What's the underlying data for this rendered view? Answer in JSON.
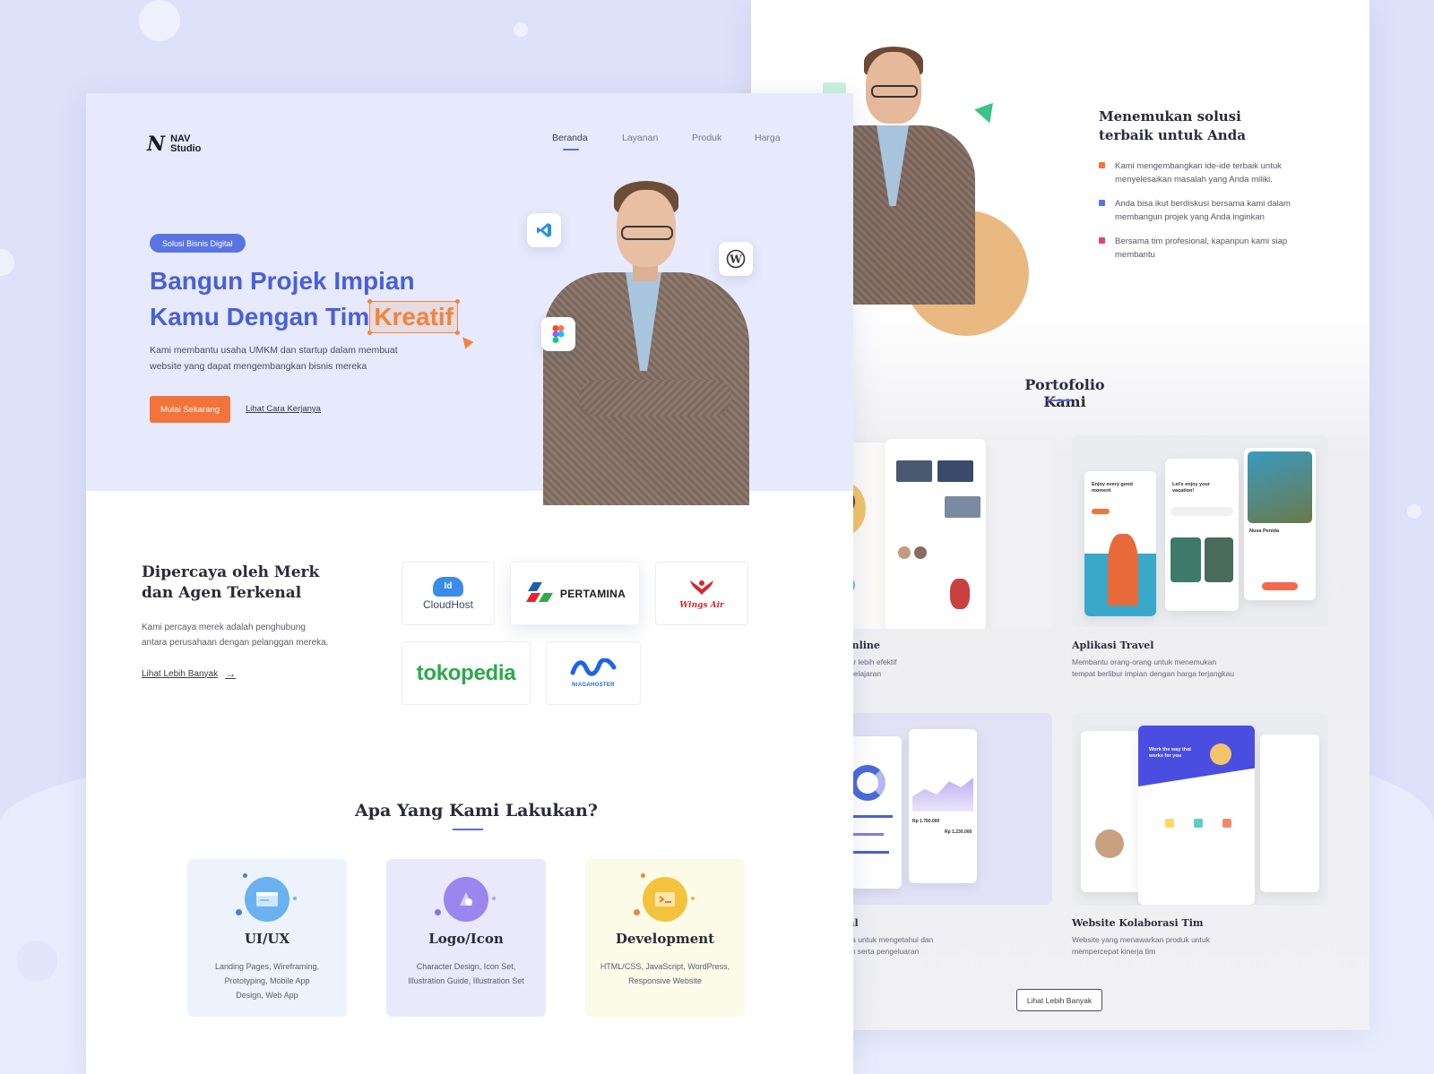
{
  "brand": {
    "mark": "N",
    "line1": "NAV",
    "line2": "Studio"
  },
  "nav": {
    "items": [
      "Beranda",
      "Layanan",
      "Produk",
      "Harga"
    ]
  },
  "hero": {
    "badge": "Solusi Bisnis Digital",
    "title_line1": "Bangun Projek Impian",
    "title_line2_prefix": "Kamu Dengan Tim",
    "title_highlight": "Kreatif",
    "desc_line1": "Kami membantu usaha UMKM dan startup dalam membuat",
    "desc_line2": "website yang dapat mengembangkan bisnis mereka",
    "cta_primary": "Mulai Sekarang",
    "cta_secondary": "Lihat Cara Kerjanya"
  },
  "float_icons": [
    "vscode-icon",
    "wordpress-icon",
    "figma-icon"
  ],
  "trusted": {
    "title_line1": "Dipercaya oleh Merk",
    "title_line2": "dan Agen Terkenal",
    "desc_line1": "Kami percaya merek adalah penghubung",
    "desc_line2": "antara perusahaan dengan pelanggan mereka.",
    "link": "Lihat Lebih Banyak",
    "logos": {
      "cloudhost_badge": "Id",
      "cloudhost": "CloudHost",
      "pertamina": "PERTAMINA",
      "wings": "Wings Air",
      "tokopedia": "tokopedia",
      "niagahoster": "NIAGAHOSTER"
    }
  },
  "services": {
    "title": "Apa Yang Kami Lakukan?",
    "items": [
      {
        "name": "UI/UX",
        "desc_line1": "Landing Pages, Wireframing,",
        "desc_line2": "Prototyping, Mobile App",
        "desc_line3": "Design, Web App"
      },
      {
        "name": "Logo/Icon",
        "desc_line1": "Character Design, Icon Set,",
        "desc_line2": "Illustration Guide, Illustration Set",
        "desc_line3": ""
      },
      {
        "name": "Development",
        "desc_line1": "HTML/CSS, JavaScript, WordPress,",
        "desc_line2": "Responsive Website",
        "desc_line3": ""
      }
    ]
  },
  "solutions": {
    "title_line1": "Menemukan solusi",
    "title_line2": "terbaik untuk Anda",
    "points": [
      {
        "line1": "Kami mengembangkan ide-ide terbaik untuk",
        "line2": "menyelesaikan masalah yang Anda miliki.",
        "color": "#f2743a"
      },
      {
        "line1": "Anda bisa ikut berdiskusi bersama kami dalam",
        "line2": "membangun projek yang Anda inginkan",
        "color": "#5b74e3"
      },
      {
        "line1": "Bersama tim profesional, kapanpun kami siap",
        "line2": "membantu",
        "color": "#e8407a"
      }
    ]
  },
  "portfolio": {
    "title": "Portofolio Kami",
    "items": [
      {
        "title": "Online",
        "desc_line1": "ajar lebih efektif",
        "desc_line2": "mbelajaran"
      },
      {
        "title": "Aplikasi Travel",
        "desc_line1": "Membantu orang-orang untuk menemukan",
        "desc_line2": "tempat berlibur impian dengan harga terjangkau"
      },
      {
        "title": "sial",
        "desc_line1": "guna untuk mengetahui dan",
        "desc_line2": "ukan serta pengeluaran"
      },
      {
        "title": "Website Kolaborasi Tim",
        "desc_line1": "Website yang menawarkan produk untuk",
        "desc_line2": "mempercepat kinerja tim"
      }
    ],
    "mock_texts": {
      "travel_headline": "Enjoy every good moment",
      "travel_vacation": "Let's enjoy your vacation!",
      "travel_place": "Nusa Penida",
      "finance_balance": "Rp 1.760.000",
      "finance_balance2": "Rp 1.230.000",
      "collab_headline": "Work the way that works for you"
    },
    "more_button": "Lihat Lebih Banyak"
  },
  "colors": {
    "accent_blue": "#4a5fd8",
    "accent_orange": "#f2743a",
    "hero_bg": "#e6eafc"
  }
}
